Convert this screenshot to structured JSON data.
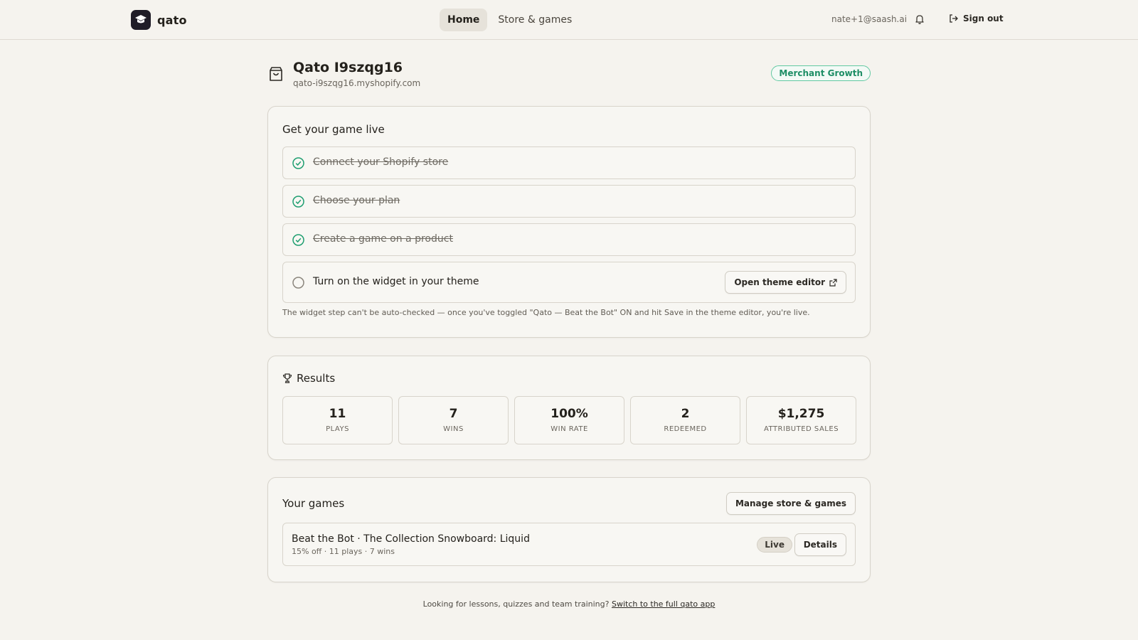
{
  "header": {
    "brand_name": "qato",
    "nav": [
      {
        "label": "Home",
        "active": true
      },
      {
        "label": "Store & games",
        "active": false
      }
    ],
    "user_email": "nate+1@saash.ai",
    "sign_out_label": "Sign out"
  },
  "store": {
    "title": "Qato I9szqg16",
    "domain": "qato-i9szqg16.myshopify.com",
    "plan_badge": "Merchant Growth"
  },
  "checklist": {
    "title": "Get your game live",
    "steps": [
      {
        "label": "Connect your Shopify store",
        "done": true
      },
      {
        "label": "Choose your plan",
        "done": true
      },
      {
        "label": "Create a game on a product",
        "done": true
      },
      {
        "label": "Turn on the widget in your theme",
        "done": false
      }
    ],
    "open_theme_editor_label": "Open theme editor",
    "hint": "The widget step can't be auto-checked — once you've toggled \"Qato — Beat the Bot\" ON and hit Save in the theme editor, you're live."
  },
  "results": {
    "title": "Results",
    "stats": [
      {
        "value": "11",
        "label": "PLAYS"
      },
      {
        "value": "7",
        "label": "WINS"
      },
      {
        "value": "100%",
        "label": "WIN RATE"
      },
      {
        "value": "2",
        "label": "REDEEMED"
      },
      {
        "value": "$1,275",
        "label": "ATTRIBUTED SALES"
      }
    ]
  },
  "games": {
    "title": "Your games",
    "manage_label": "Manage store & games",
    "items": [
      {
        "title": "Beat the Bot · The Collection Snowboard: Liquid",
        "meta": "15% off · 11 plays · 7 wins",
        "status": "Live",
        "details_label": "Details"
      }
    ]
  },
  "footer": {
    "prefix": "Looking for lessons, quizzes and team training?",
    "link": "Switch to the full qato app"
  },
  "colors": {
    "background": "#f5f3ee",
    "accent_green": "#1e8e66",
    "brand_dark": "#1f1c27"
  },
  "icons": {
    "brand": "graduation-cap-icon",
    "notifications": "bell-icon",
    "sign_out": "sign-out-icon",
    "store": "shopping-bag-icon",
    "step_done": "check-circle-icon",
    "step_todo": "empty-circle-icon",
    "external": "external-link-icon",
    "results": "trophy-icon"
  }
}
